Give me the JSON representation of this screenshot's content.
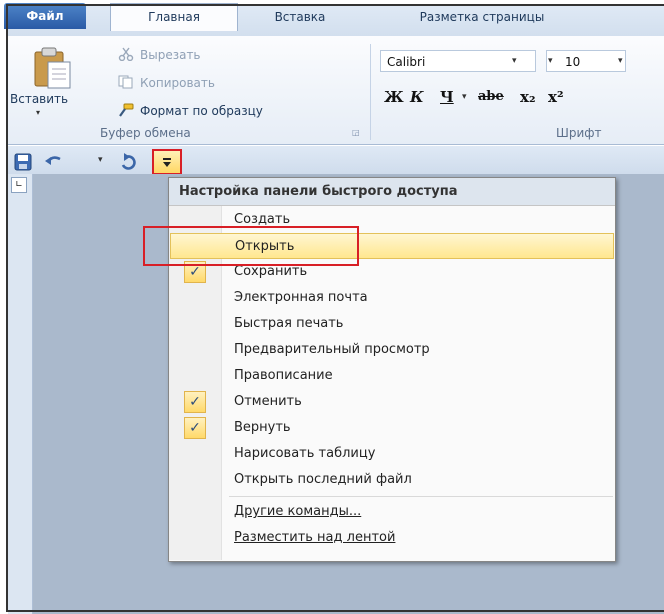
{
  "tabs": {
    "file": "Файл",
    "home": "Главная",
    "insert": "Вставка",
    "layout": "Разметка страницы"
  },
  "clipboard": {
    "paste": "Вставить",
    "cut": "Вырезать",
    "copy": "Копировать",
    "format_painter": "Формат по образцу",
    "group_label": "Буфер обмена"
  },
  "font": {
    "name": "Calibri",
    "size": "10",
    "bold": "Ж",
    "italic": "К",
    "underline": "Ч",
    "strike": "abe",
    "subscript": "x₂",
    "superscript": "x²",
    "group_label": "Шрифт"
  },
  "qat_menu": {
    "title": "Настройка панели быстрого доступа",
    "items": [
      {
        "label": "Создать",
        "checked": false
      },
      {
        "label": "Открыть",
        "checked": false,
        "highlighted": true
      },
      {
        "label": "Сохранить",
        "checked": true
      },
      {
        "label": "Электронная почта",
        "checked": false
      },
      {
        "label": "Быстрая печать",
        "checked": false
      },
      {
        "label": "Предварительный просмотр",
        "checked": false
      },
      {
        "label": "Правописание",
        "checked": false
      },
      {
        "label": "Отменить",
        "checked": true
      },
      {
        "label": "Вернуть",
        "checked": true
      },
      {
        "label": "Нарисовать таблицу",
        "checked": false
      },
      {
        "label": "Открыть последний файл",
        "checked": false
      }
    ],
    "more_commands": "Другие команды...",
    "place_above": "Разместить над лентой"
  },
  "colors": {
    "accent_red": "#d81f26",
    "hover": "#ffe78f",
    "ribbon": "#dfe9f5"
  }
}
